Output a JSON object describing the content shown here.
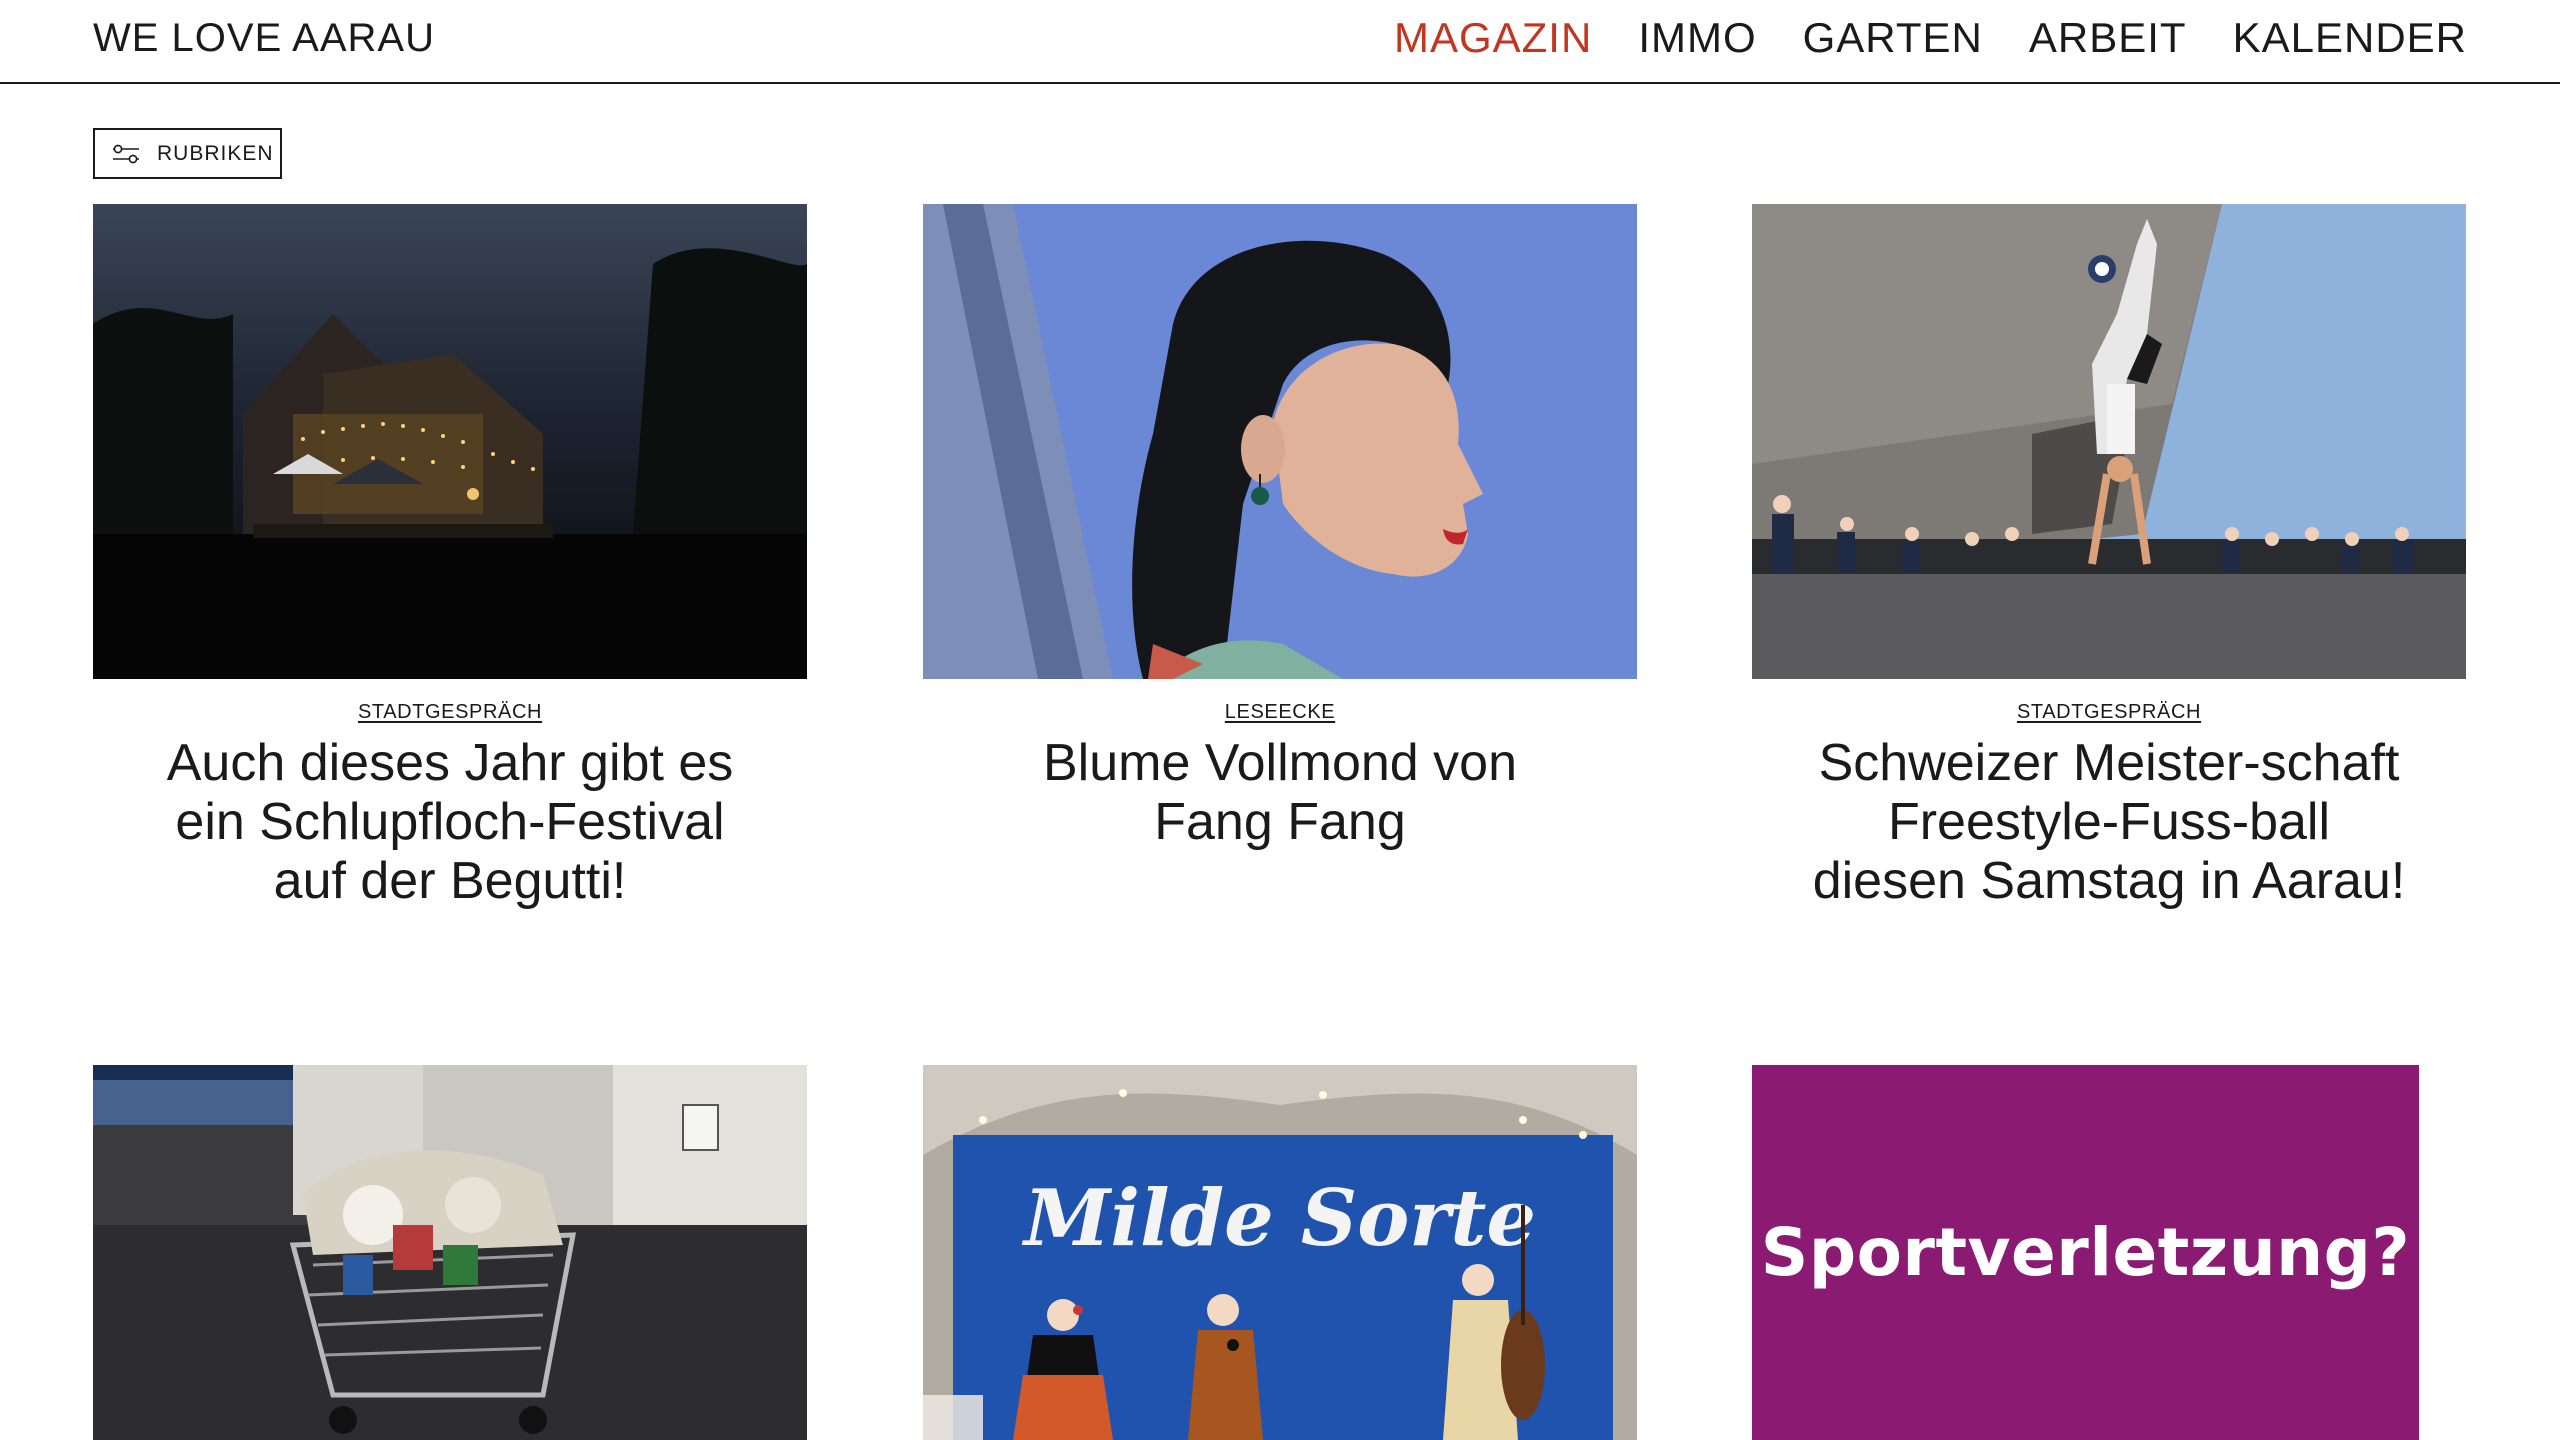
{
  "header": {
    "site_title": "WE LOVE AARAU",
    "nav": [
      {
        "label": "MAGAZIN",
        "active": true
      },
      {
        "label": "IMMO",
        "active": false
      },
      {
        "label": "GARTEN",
        "active": false
      },
      {
        "label": "ARBEIT",
        "active": false
      },
      {
        "label": "KALENDER",
        "active": false
      }
    ],
    "active_color": "#c2361f"
  },
  "filter": {
    "label": "RUBRIKEN",
    "icon": "sliders-icon"
  },
  "articles": [
    {
      "category": "STADTGESPRÄCH",
      "title": "Auch dieses Jahr gibt es ein Schlupfloch-Festival auf der Begutti!",
      "image": "night-house-festival-photo"
    },
    {
      "category": "LESEECKE",
      "title": "Blume Vollmond von Fang Fang",
      "image": "woman-portrait-photo"
    },
    {
      "category": "STADTGESPRÄCH",
      "title": "Schweizer Meister-schaft Freestyle-Fuss-ball diesen Samstag in Aarau!",
      "image": "freestyle-football-photo"
    },
    {
      "image": "shopping-cart-photo"
    },
    {
      "image": "band-stage-photo",
      "banner_text": "Milde Sorte"
    }
  ],
  "ad": {
    "text": "Sportverletzung?",
    "background": "#8b1a73"
  }
}
